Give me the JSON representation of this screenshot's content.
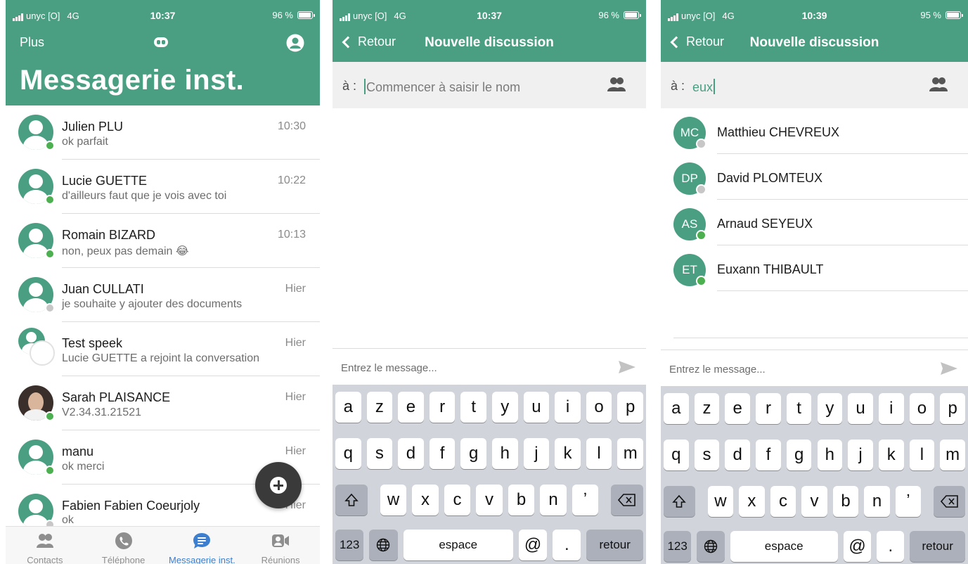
{
  "status_bars": [
    {
      "carrier": "unyc [O]",
      "network": "4G",
      "time": "10:37",
      "battery": "96 %",
      "battery_level": 0.96
    },
    {
      "carrier": "unyc [O]",
      "network": "4G",
      "time": "10:37",
      "battery": "96 %",
      "battery_level": 0.96
    },
    {
      "carrier": "unyc [O]",
      "network": "4G",
      "time": "10:39",
      "battery": "95 %",
      "battery_level": 0.95
    }
  ],
  "colors": {
    "brand": "#4a9f82",
    "online": "#4caf50",
    "offline": "#c7c7c7",
    "active_tab": "#3c7fd0"
  },
  "messaging": {
    "plus_label": "Plus",
    "header_icon": "chat-bubble-icon",
    "profile_icon": "profile-icon",
    "title": "Messagerie inst.",
    "conversations": [
      {
        "name": "Julien PLU",
        "message": "ok parfait",
        "time": "10:30",
        "status": "online"
      },
      {
        "name": "Lucie GUETTE",
        "message": "d'ailleurs faut que je vois avec toi",
        "time": "10:22",
        "status": "online"
      },
      {
        "name": "Romain BIZARD",
        "message": "non, peux pas demain 😂",
        "time": "10:13",
        "status": "online"
      },
      {
        "name": "Juan CULLATI",
        "message": "je souhaite y ajouter des documents",
        "time": "Hier",
        "status": "offline"
      },
      {
        "name": "Test speek",
        "message": "Lucie GUETTE a rejoint la conversation",
        "time": "Hier",
        "status": "group"
      },
      {
        "name": "Sarah PLAISANCE",
        "message": "V2.34.31.21521",
        "time": "Hier",
        "status": "online",
        "photo": true
      },
      {
        "name": "manu",
        "message": "ok merci",
        "time": "Hier",
        "status": "online"
      },
      {
        "name": "Fabien Fabien Coeurjoly",
        "message": "ok",
        "time": "Hier",
        "status": "offline"
      }
    ],
    "fab_icon": "add-icon",
    "tabs": [
      {
        "label": "Contacts",
        "icon": "contacts-icon",
        "active": false
      },
      {
        "label": "Téléphone",
        "icon": "phone-icon",
        "active": false
      },
      {
        "label": "Messagerie inst.",
        "icon": "chat-icon",
        "active": true
      },
      {
        "label": "Réunions",
        "icon": "video-icon",
        "active": false
      }
    ]
  },
  "new_discussion_empty": {
    "back_label": "Retour",
    "title": "Nouvelle discussion",
    "to_label": "à :",
    "to_placeholder": "Commencer à saisir le nom",
    "message_placeholder": "Entrez le message..."
  },
  "new_discussion_search": {
    "back_label": "Retour",
    "title": "Nouvelle discussion",
    "to_label": "à :",
    "to_value": "eux",
    "message_placeholder": "Entrez le message...",
    "results": [
      {
        "initials": "MC",
        "name": "Matthieu CHEVREUX",
        "status": "offline"
      },
      {
        "initials": "DP",
        "name": "David PLOMTEUX",
        "status": "offline"
      },
      {
        "initials": "AS",
        "name": "Arnaud SEYEUX",
        "status": "online"
      },
      {
        "initials": "ET",
        "name": "Euxann THIBAULT",
        "status": "online"
      }
    ]
  },
  "keyboard": {
    "row1": [
      "a",
      "z",
      "e",
      "r",
      "t",
      "y",
      "u",
      "i",
      "o",
      "p"
    ],
    "row2": [
      "q",
      "s",
      "d",
      "f",
      "g",
      "h",
      "j",
      "k",
      "l",
      "m"
    ],
    "row3": [
      "w",
      "x",
      "c",
      "v",
      "b",
      "n",
      "ʼ"
    ],
    "numbers_key": "123",
    "space_key": "espace",
    "at_key": "@",
    "dot_key": ".",
    "return_key": "retour"
  }
}
